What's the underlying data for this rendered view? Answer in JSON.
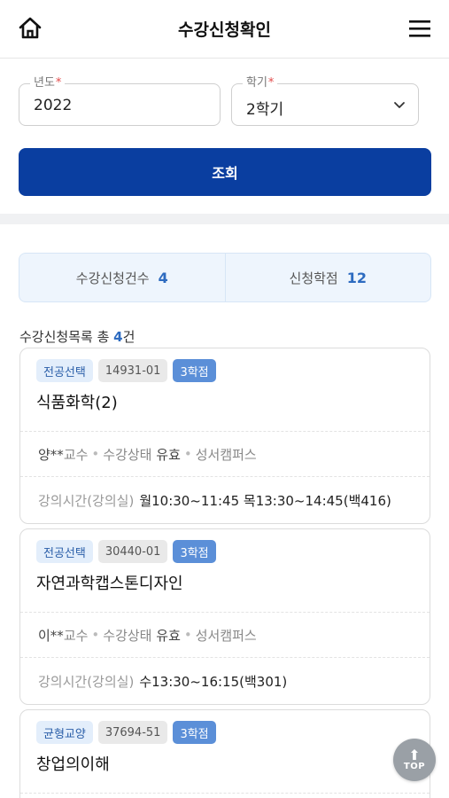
{
  "header": {
    "title": "수강신청확인",
    "home_icon": "home-icon",
    "menu_icon": "hamburger-menu-icon"
  },
  "filters": {
    "year_label": "년도",
    "year_value": "2022",
    "term_label": "학기",
    "term_value": "2학기",
    "required_mark": "*",
    "search_label": "조회"
  },
  "summary": {
    "count_label": "수강신청건수",
    "count_value": "4",
    "credit_label": "신청학점",
    "credit_value": "12"
  },
  "list": {
    "title_prefix": "수강신청목록 총 ",
    "count": "4",
    "title_suffix": "건"
  },
  "courses": [
    {
      "type": "전공선택",
      "code": "14931-01",
      "credit": "3학점",
      "name": "식품화학(2)",
      "professor": "양**",
      "professor_suffix": "교수",
      "status_label": "수강상태",
      "status_value": "유효",
      "campus": "성서캠퍼스",
      "time_label": "강의시간(강의실)",
      "time_value": "월10:30~11:45 목13:30~14:45(백416)"
    },
    {
      "type": "전공선택",
      "code": "30440-01",
      "credit": "3학점",
      "name": "자연과학캡스톤디자인",
      "professor": "이**",
      "professor_suffix": "교수",
      "status_label": "수강상태",
      "status_value": "유효",
      "campus": "성서캠퍼스",
      "time_label": "강의시간(강의실)",
      "time_value": "수13:30~16:15(백301)"
    },
    {
      "type": "균형교양",
      "code": "37694-51",
      "credit": "3학점",
      "name": "창업의이해"
    }
  ],
  "top_button": {
    "label": "TOP",
    "arrow": "⬆"
  },
  "colors": {
    "primary": "#0a3ea0",
    "accent": "#2d6bc0",
    "credit_tag": "#5b8fd8"
  }
}
